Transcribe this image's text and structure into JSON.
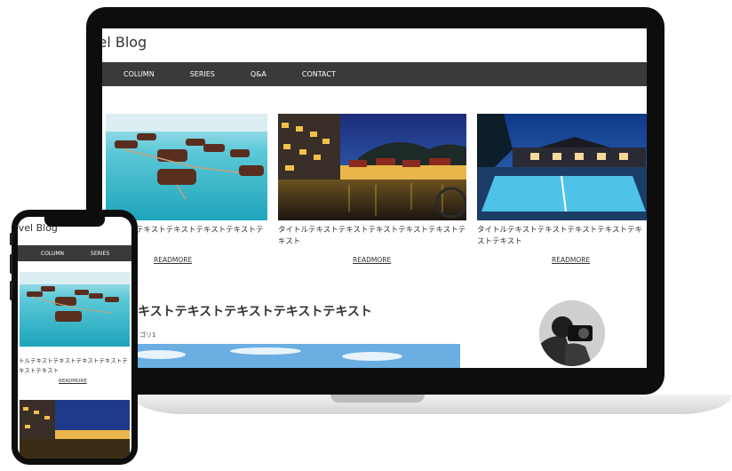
{
  "site": {
    "logo": "vel Blog",
    "nav": [
      "COLUMN",
      "SERIES",
      "Q&A",
      "CONTACT"
    ]
  },
  "cards": [
    {
      "title": "タイトルテキストテキストテキストテキストテキスト",
      "readmore": "READMORE",
      "image": "overwater-villas-photo"
    },
    {
      "title": "タイトルテキストテキストテキストテキストテキストテキスト",
      "readmore": "READMORE",
      "image": "river-town-night-photo"
    },
    {
      "title": "タイトルテキストテキストテキストテキストテキストテキスト",
      "readmore": "READMORE",
      "image": "resort-pool-night-photo"
    }
  ],
  "post": {
    "title": "キストテキストテキストテキストテキスト",
    "category": "ゴリ1"
  },
  "phone": {
    "logo": "avel Blog",
    "nav": [
      "COLUMN",
      "SERIES"
    ],
    "card_title": "トルテキストテキストテキストテキストテキストテキスト",
    "readmore": "READMORE"
  },
  "colors": {
    "nav_bg": "#3a3a3a",
    "device_frame": "#0d0d0d"
  }
}
